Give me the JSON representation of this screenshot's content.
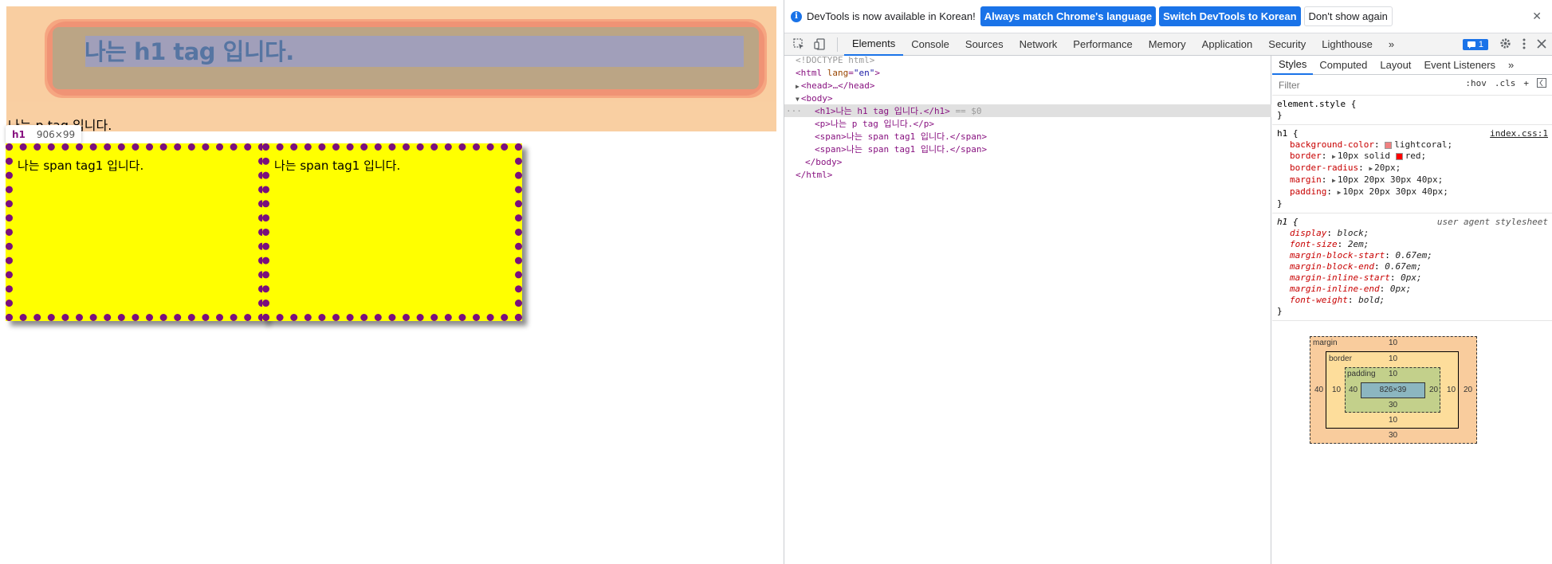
{
  "page": {
    "h1_text": "나는 h1 tag 입니다.",
    "p_text": "나는 p tag 입니다.",
    "span1_text": "나는 span tag1 입니다.",
    "span2_text": "나는 span tag1 입니다.",
    "tooltip": {
      "tag": "h1",
      "dims": "906×99"
    }
  },
  "infobar": {
    "message": "DevTools is now available in Korean!",
    "btn_match": "Always match Chrome's language",
    "btn_switch": "Switch DevTools to Korean",
    "btn_dismiss": "Don't show again",
    "close": "✕"
  },
  "tabs": [
    "Elements",
    "Console",
    "Sources",
    "Network",
    "Performance",
    "Memory",
    "Application",
    "Security",
    "Lighthouse"
  ],
  "tabs_more": "»",
  "issues_badge": "1",
  "dom": {
    "doctype": "<!DOCTYPE html>",
    "html_open_tag": "<html",
    "html_attr": "lang",
    "html_val": "\"en\"",
    "html_close_bracket": ">",
    "head": "<head>…</head>",
    "body_open": "<body>",
    "h1_line": "<h1>나는 h1 tag 입니다.</h1>",
    "h1_suffix": "== $0",
    "p_line": "<p>나는 p tag 입니다.</p>",
    "span1_line": "<span>나는 span tag1 입니다.</span>",
    "span2_line": "<span>나는 span tag1 입니다.</span>",
    "body_close": "</body>",
    "html_close": "</html>",
    "dots": "···"
  },
  "styles": {
    "tabs": [
      "Styles",
      "Computed",
      "Layout",
      "Event Listeners"
    ],
    "tabs_more": "»",
    "filter_placeholder": "Filter",
    "hov": ":hov",
    "cls": ".cls",
    "plus": "+",
    "element_style": "element.style {",
    "close_brace": "}",
    "rule1": {
      "selector": "h1 {",
      "source": "index.css:1",
      "decls": [
        {
          "name": "background-color",
          "value": "lightcoral;",
          "swatch": "#f08080"
        },
        {
          "name": "border",
          "value": "10px solid",
          "swatch2": "#ff0000",
          "value2": "red;",
          "tri": true
        },
        {
          "name": "border-radius",
          "value": "20px;",
          "tri": true
        },
        {
          "name": "margin",
          "value": "10px 20px 30px 40px;",
          "tri": true
        },
        {
          "name": "padding",
          "value": "10px 20px 30px 40px;",
          "tri": true
        }
      ]
    },
    "rule2": {
      "selector": "h1 {",
      "source": "user agent stylesheet",
      "decls": [
        {
          "name": "display",
          "value": "block;"
        },
        {
          "name": "font-size",
          "value": "2em;"
        },
        {
          "name": "margin-block-start",
          "value": "0.67em;"
        },
        {
          "name": "margin-block-end",
          "value": "0.67em;"
        },
        {
          "name": "margin-inline-start",
          "value": "0px;"
        },
        {
          "name": "margin-inline-end",
          "value": "0px;"
        },
        {
          "name": "font-weight",
          "value": "bold;"
        }
      ]
    }
  },
  "box_model": {
    "margin_label": "margin",
    "border_label": "border",
    "padding_label": "padding",
    "margin": {
      "top": "10",
      "right": "20",
      "bottom": "30",
      "left": "40"
    },
    "border": {
      "top": "10",
      "right": "10",
      "bottom": "10",
      "left": "10"
    },
    "padding": {
      "top": "10",
      "right": "20",
      "bottom": "30",
      "left": "40"
    },
    "content": "826×39"
  },
  "colors": {
    "accent": "#1a73e8",
    "span_bg": "#ffff00",
    "span_border": "#7a0f7d",
    "margin_overlay": "#f9cc9d",
    "padding_overlay": "#c3d08b",
    "content_overlay": "#8cb6c0"
  }
}
